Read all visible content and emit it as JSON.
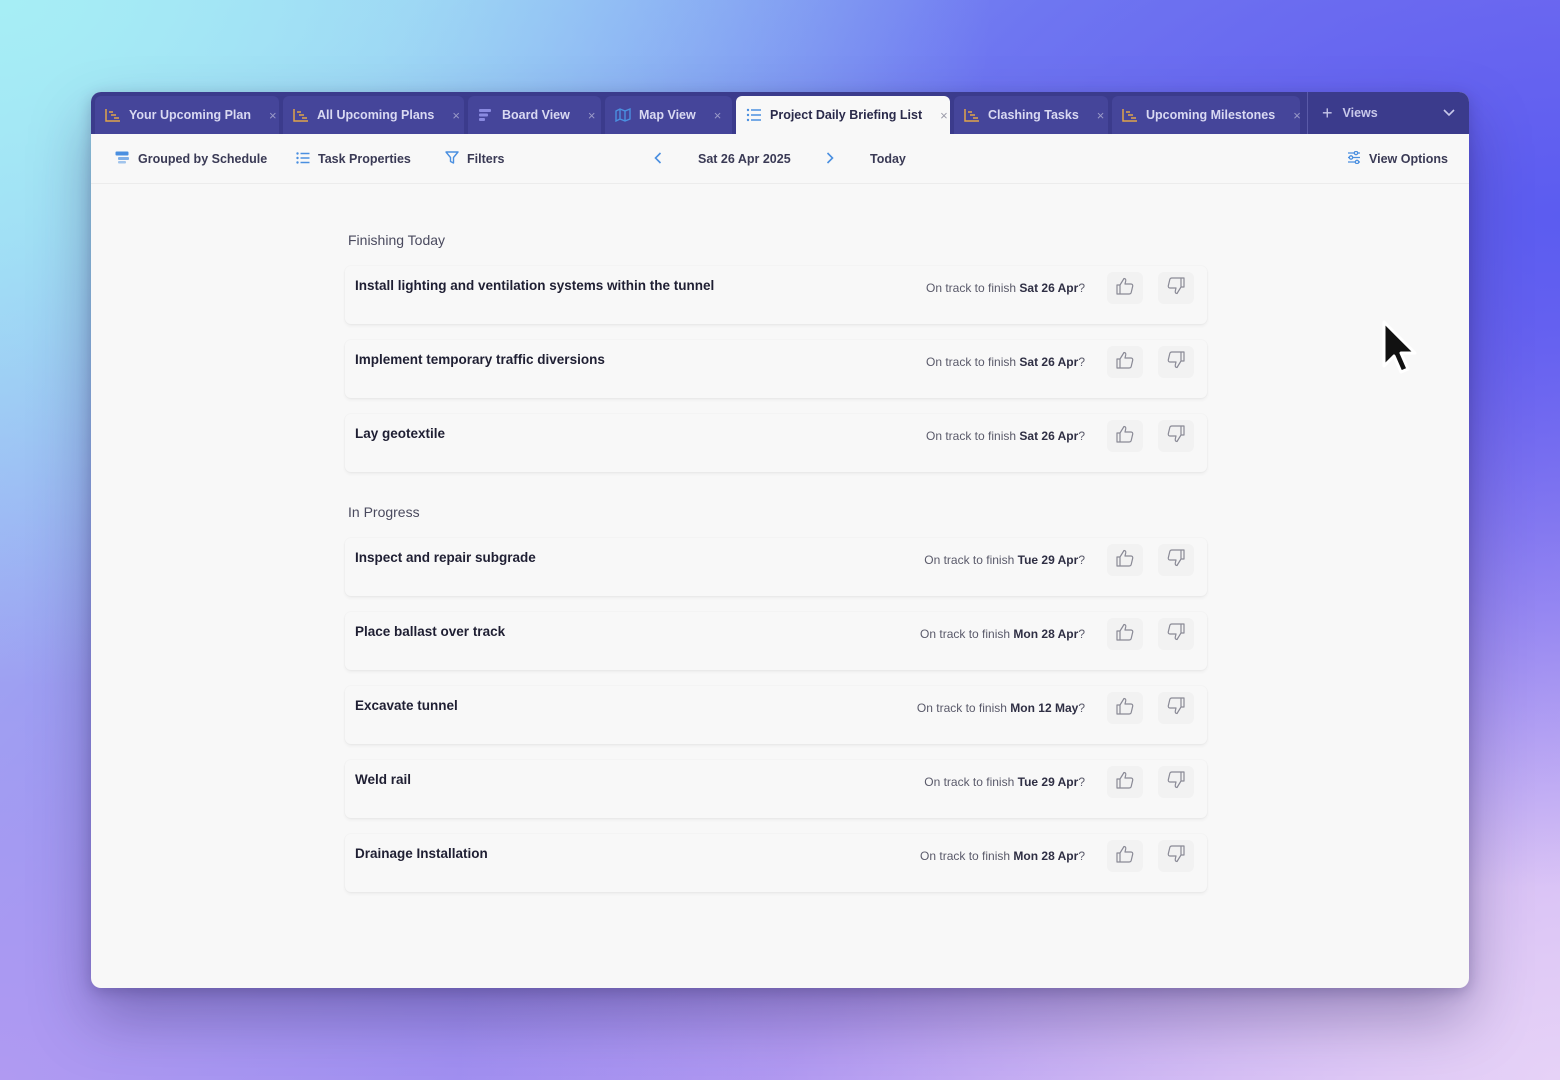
{
  "tabs": [
    {
      "label": "Your Upcoming Plan",
      "icon": "gantt-icon",
      "active": false
    },
    {
      "label": "All Upcoming Plans",
      "icon": "gantt-icon",
      "active": false
    },
    {
      "label": "Board View",
      "icon": "board-icon",
      "active": false
    },
    {
      "label": "Map View",
      "icon": "map-icon",
      "active": false
    },
    {
      "label": "Project Daily Briefing List",
      "icon": "list-icon",
      "active": true
    },
    {
      "label": "Clashing Tasks",
      "icon": "gantt-icon",
      "active": false
    },
    {
      "label": "Upcoming Milestones",
      "icon": "gantt-icon",
      "active": false
    }
  ],
  "tab_close": "×",
  "views": {
    "plus": "+",
    "label": "Views"
  },
  "toolbar": {
    "group_label": "Grouped by Schedule",
    "properties_label": "Task Properties",
    "filters_label": "Filters",
    "date_label": "Sat 26 Apr 2025",
    "today_label": "Today",
    "view_options_label": "View Options"
  },
  "status_prefix": "On track to finish",
  "sections": [
    {
      "title": "Finishing Today",
      "tasks": [
        {
          "name": "Install lighting and ventilation systems within the tunnel",
          "finish": "Sat 26 Apr"
        },
        {
          "name": "Implement temporary traffic diversions",
          "finish": "Sat 26 Apr"
        },
        {
          "name": "Lay geotextile",
          "finish": "Sat 26 Apr"
        }
      ]
    },
    {
      "title": "In Progress",
      "tasks": [
        {
          "name": "Inspect and repair subgrade",
          "finish": "Tue 29 Apr"
        },
        {
          "name": "Place ballast over track",
          "finish": "Mon 28 Apr"
        },
        {
          "name": "Excavate tunnel",
          "finish": "Mon 12 May"
        },
        {
          "name": "Weld rail",
          "finish": "Tue 29 Apr"
        },
        {
          "name": "Drainage Installation",
          "finish": "Mon 28 Apr"
        }
      ]
    }
  ],
  "colors": {
    "tabbar": "#3b3b8c",
    "tab": "#45459a",
    "accent": "#4a8fe0",
    "icon_orange": "#e0a44a"
  }
}
